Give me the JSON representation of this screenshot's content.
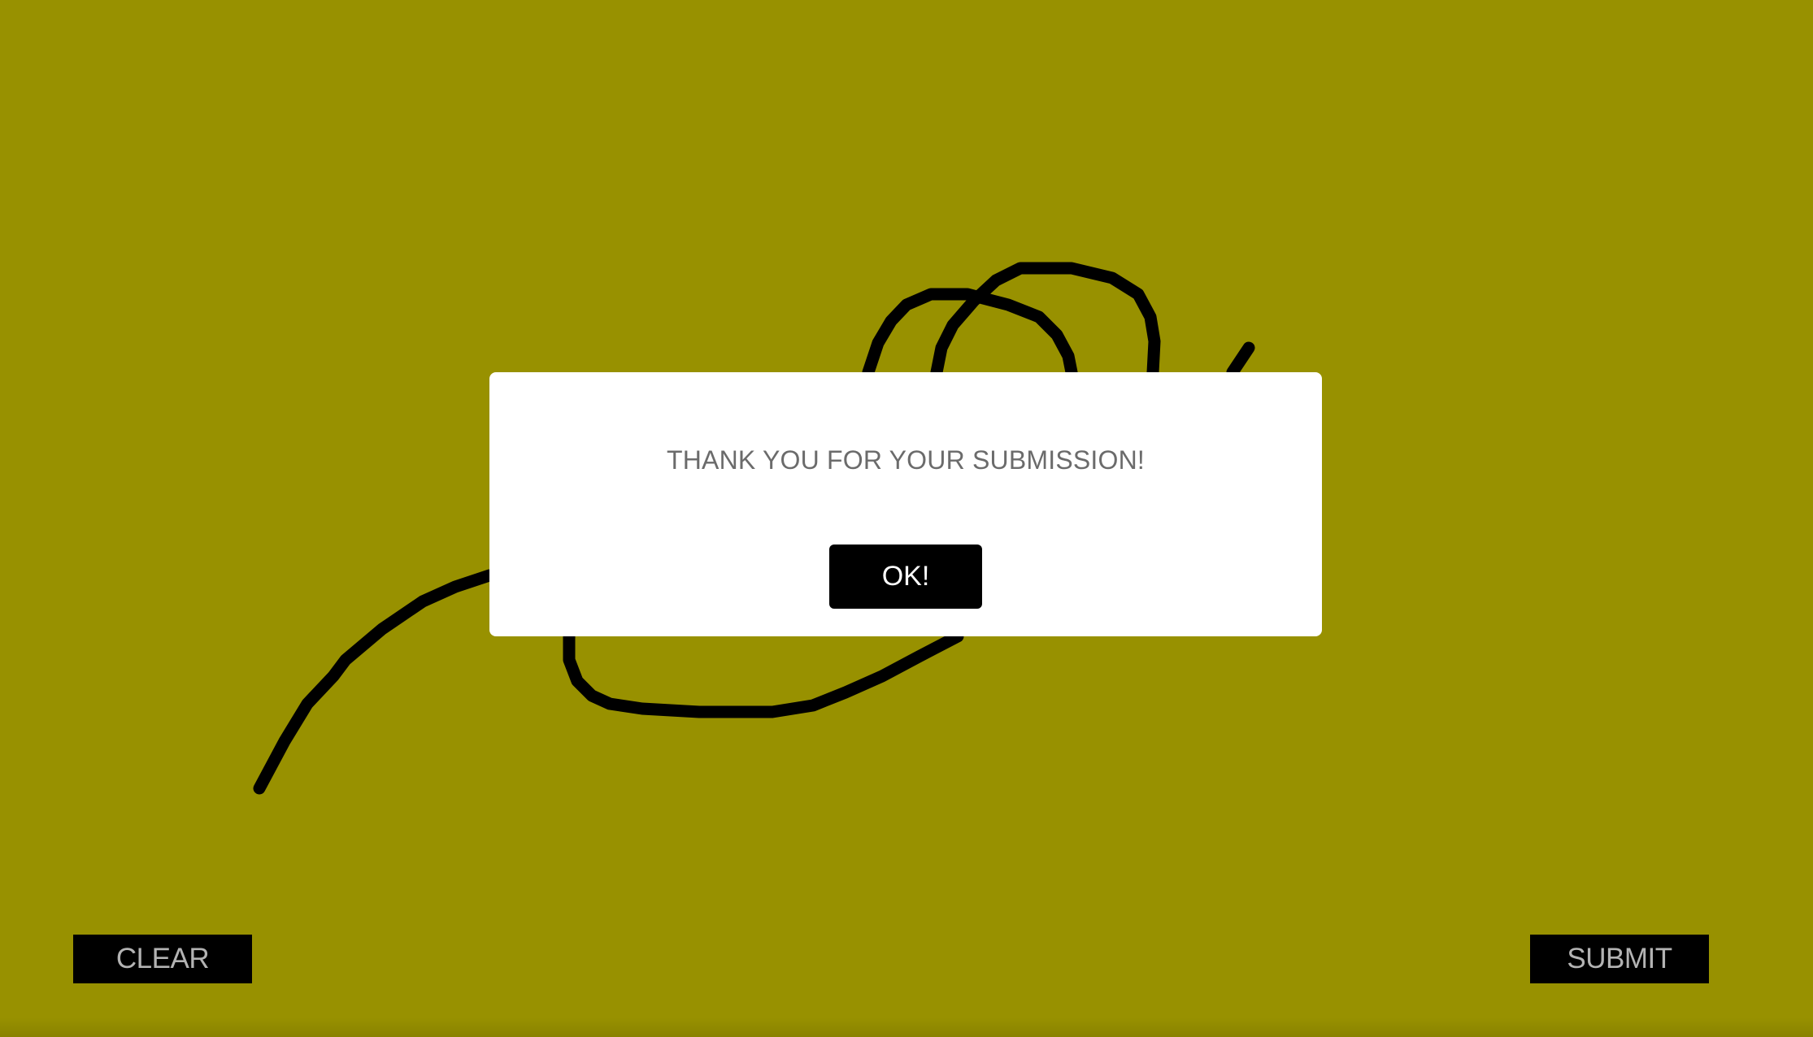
{
  "colors": {
    "background": "#989100",
    "stroke": "#000000",
    "modal_background": "#ffffff",
    "button_background": "#000000",
    "control_label": "#b3b3b3",
    "message_text": "#6b6b6b"
  },
  "controls": {
    "clear_label": "CLEAR",
    "submit_label": "SUBMIT"
  },
  "dialog": {
    "message": "THANK YOU FOR YOUR SUBMISSION!",
    "ok_label": "OK!"
  }
}
